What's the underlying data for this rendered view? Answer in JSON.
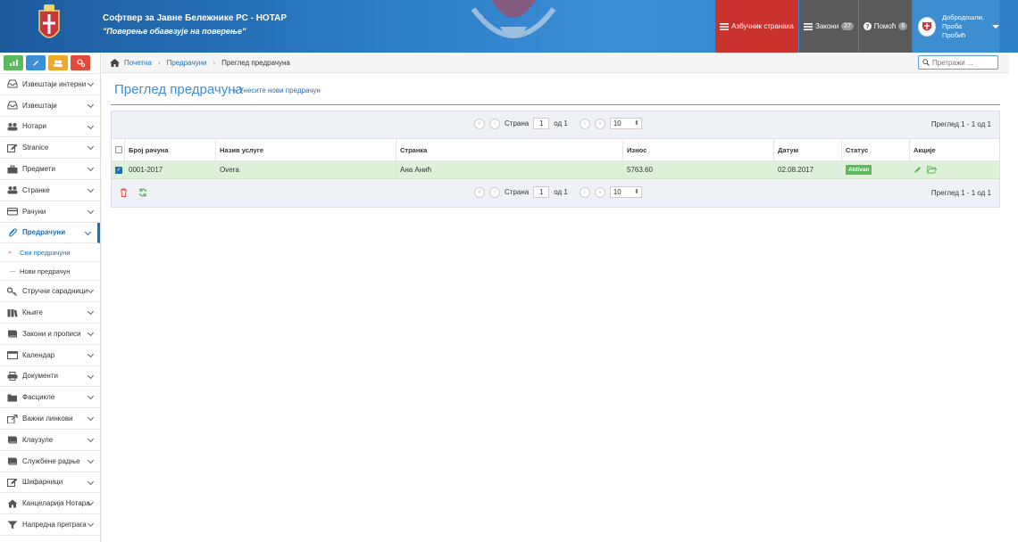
{
  "header": {
    "title": "Софтвер за Јавне Бележнике РС - НОТАР",
    "motto": "\"Поверење обавезује на поверење\"",
    "alphabet_label": "Азбучник странака",
    "laws_label": "Закони",
    "laws_count": "27",
    "help_label": "Помоћ",
    "help_count": "6",
    "greeting": "Добродошли,",
    "user_first": "Проба",
    "user_last": "Пробић"
  },
  "sidebar": {
    "tool_icons": [
      "chart-icon",
      "pencil-icon",
      "users-icon",
      "settings-icon"
    ],
    "items_top": [
      {
        "label": "Извештаји интерни",
        "icon": "inbox-icon"
      },
      {
        "label": "Извештаји",
        "icon": "inbox-icon"
      },
      {
        "label": "Нотари",
        "icon": "users-icon"
      },
      {
        "label": "Stranice",
        "icon": "edit-icon"
      },
      {
        "label": "Предмети",
        "icon": "briefcase-icon"
      },
      {
        "label": "Странке",
        "icon": "users-icon"
      },
      {
        "label": "Рачуни",
        "icon": "card-icon"
      },
      {
        "label": "Предрачуни",
        "icon": "paperclip-icon"
      }
    ],
    "sub_items": [
      {
        "label": "Сви предрачуни"
      },
      {
        "label": "Нови предрачун"
      }
    ],
    "items_bottom": [
      {
        "label": "Стручни сарадници",
        "icon": "key-icon"
      },
      {
        "label": "Књиге",
        "icon": "books-icon"
      },
      {
        "label": "Закони и прописи",
        "icon": "book-icon"
      },
      {
        "label": "Календар",
        "icon": "calendar-icon"
      },
      {
        "label": "Документи",
        "icon": "print-icon"
      },
      {
        "label": "Фасцикле",
        "icon": "folder-icon"
      },
      {
        "label": "Важни линкови",
        "icon": "external-link-icon"
      },
      {
        "label": "Клаузуле",
        "icon": "book-icon"
      },
      {
        "label": "Службене радње",
        "icon": "book-icon"
      },
      {
        "label": "Шифарници",
        "icon": "edit-icon"
      },
      {
        "label": "Канцеларија Нотара",
        "icon": "home-icon"
      },
      {
        "label": "Напредна претрага",
        "icon": "filter-icon"
      }
    ]
  },
  "breadcrumb": {
    "home": "Почетна",
    "section": "Предрачуни",
    "current": "Преглед предрачуна"
  },
  "search": {
    "placeholder": "Претражи ..."
  },
  "page": {
    "title": "Преглед предрачуна",
    "new_link": "» Унесите нови предрачун"
  },
  "pager": {
    "page_label": "Страна",
    "page_value": "1",
    "of_label": "од 1",
    "page_size": "10",
    "info": "Преглед 1 - 1 од 1"
  },
  "table": {
    "columns": [
      "Број рачуна",
      "Назив услуге",
      "Странка",
      "Износ",
      "Датум",
      "Статус",
      "Акције"
    ],
    "rows": [
      {
        "number": "0001-2017",
        "service": "Overa",
        "client": "Ана Анић",
        "amount": "5763.60",
        "date": "02.08.2017",
        "status": "Aktivan"
      }
    ]
  },
  "colors": {
    "accent": "#3b8fd6",
    "link": "#1f6fb6",
    "danger": "#c9322d",
    "success": "#5cb85c",
    "row_selected": "#dff0d8"
  }
}
